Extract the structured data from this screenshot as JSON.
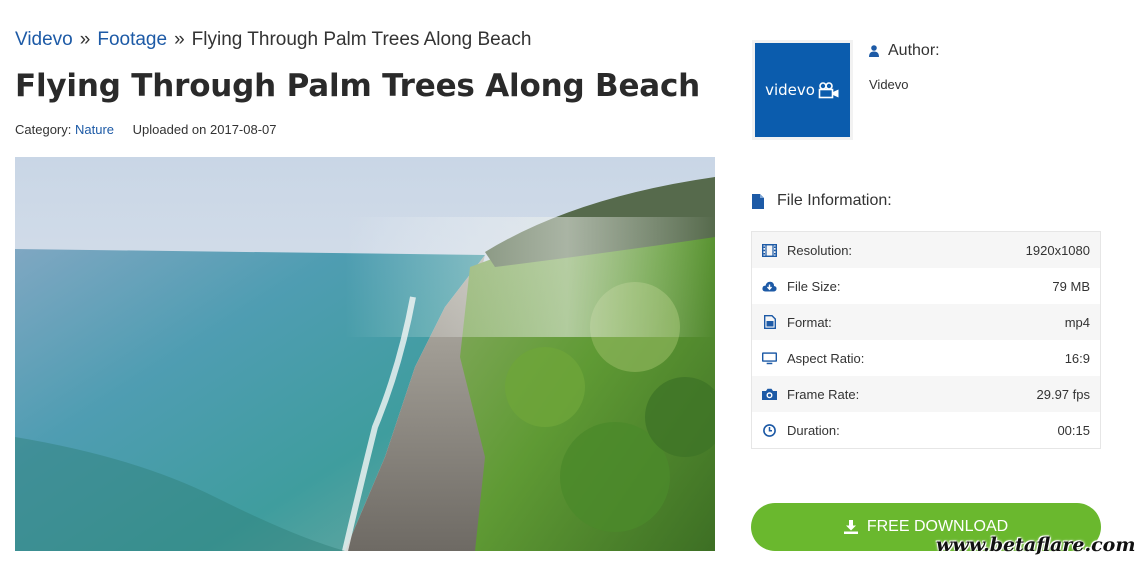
{
  "breadcrumb": {
    "items": [
      "Videvo",
      "Footage"
    ],
    "separator": "»",
    "current": "Flying Through Palm Trees Along Beach"
  },
  "page_title": "Flying Through Palm Trees Along Beach",
  "meta": {
    "category_label": "Category:",
    "category_value": "Nature",
    "uploaded_label": "Uploaded on",
    "uploaded_date": "2017-08-07"
  },
  "author": {
    "heading": "Author:",
    "name": "Videvo",
    "logo_text": "videvo",
    "logo_bg": "#0b5cad"
  },
  "file_info": {
    "heading": "File Information:",
    "rows": [
      {
        "icon": "film-icon",
        "label": "Resolution:",
        "value": "1920x1080"
      },
      {
        "icon": "cloud-download-icon",
        "label": "File Size:",
        "value": "79 MB"
      },
      {
        "icon": "file-image-icon",
        "label": "Format:",
        "value": "mp4"
      },
      {
        "icon": "monitor-icon",
        "label": "Aspect Ratio:",
        "value": "16:9"
      },
      {
        "icon": "camera-icon",
        "label": "Frame Rate:",
        "value": "29.97 fps"
      },
      {
        "icon": "clock-icon",
        "label": "Duration:",
        "value": "00:15"
      }
    ]
  },
  "download_button": {
    "label": "FREE DOWNLOAD",
    "icon": "download-icon",
    "color": "#6ab82e"
  },
  "watermark": "www.betaflare.com",
  "colors": {
    "link": "#1d5aa6",
    "icon": "#1d5aa6"
  }
}
